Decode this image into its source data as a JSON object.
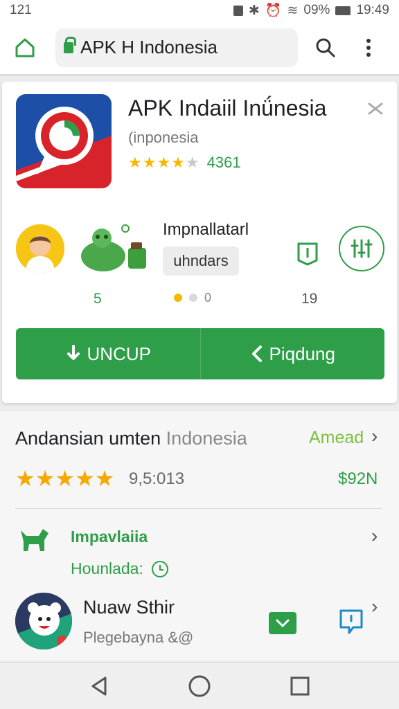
{
  "status_bar": {
    "time": "121",
    "battery": "09%",
    "clock": "19:49"
  },
  "browser": {
    "url": "APK H Indonesia",
    "icons": [
      "home-icon",
      "lock-icon",
      "search-icon",
      "more-vert-icon"
    ]
  },
  "app_card": {
    "title": "APK Indaiil Inǘnesia",
    "subtitle": "(inponesia",
    "rating_stars": 4,
    "rating_count": "4361",
    "implement_label": "Impnallatarl",
    "chip_label": "uhndars",
    "left_number": "5",
    "carousel_extra": "0",
    "right_number": "19",
    "buttons": {
      "left": "UNCUP",
      "right": "Piqdung"
    }
  },
  "section": {
    "title_main": "Andansian umten",
    "title_gray": "Indonesia",
    "link": "Amead",
    "rating_value": "9,5:013",
    "price": "$92N",
    "item1": {
      "title": "Impavlaiia",
      "subtitle": "Hounlada:"
    },
    "item2": {
      "title": "Nuaw Sthir",
      "subtitle": "Plegebayna &@"
    }
  },
  "colors": {
    "accent": "#2e9e48",
    "star": "#f5b900",
    "link": "#7cbf3f"
  },
  "nav": {
    "icons": [
      "back-icon",
      "home-circle-icon",
      "recents-icon"
    ]
  }
}
